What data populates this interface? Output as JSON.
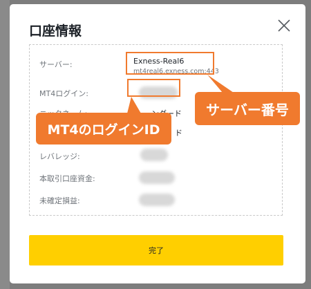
{
  "modal": {
    "title": "口座情報",
    "close_icon": "close-icon",
    "done_label": "完了"
  },
  "rows": {
    "server_label": "サーバー:",
    "server_name": "Exness-Real6",
    "server_host": "mt4real6.exness.com:443",
    "login_label": "MT4ログイン:",
    "nickname_label": "ニックネーム:",
    "nickname_value_partial": "ンダード",
    "type_value_partial": "ド",
    "leverage_label": "レバレッジ:",
    "balance_label": "本取引口座資金:",
    "unrealized_label": "未確定損益:"
  },
  "annotations": {
    "server_callout": "サーバー番号",
    "login_callout": "MT4のログインID"
  },
  "colors": {
    "accent": "#f07a2e",
    "button": "#ffcf00"
  }
}
